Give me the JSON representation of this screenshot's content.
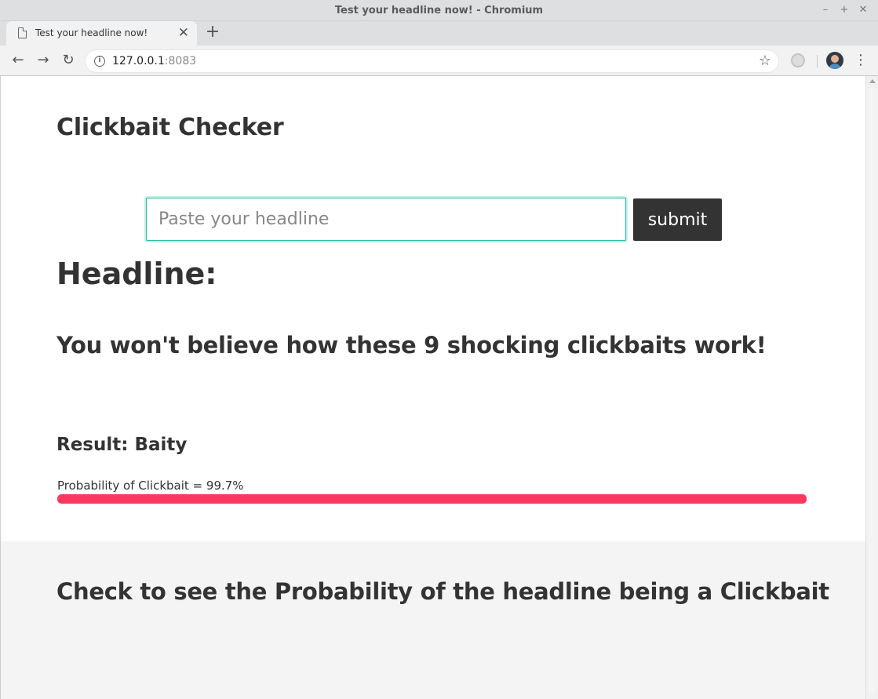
{
  "window": {
    "title": "Test your headline now! - Chromium"
  },
  "tab": {
    "label": "Test your headline now!"
  },
  "omnibox": {
    "host": "127.0.0.1",
    "port": ":8083"
  },
  "page": {
    "title": "Clickbait Checker",
    "input_placeholder": "Paste your headline",
    "input_value": "",
    "submit_label": "submit",
    "headline_label": "Headline:",
    "headline_text": "You won't believe how these 9 shocking clickbaits work!",
    "result_label": "Result: Baity",
    "probability_label": "Probability of Clickbait = 99.7%",
    "probability_value": 99.7,
    "progress_color": "#ff3860",
    "footer_text": "Check to see the Probability of the headline being a Clickbait"
  },
  "icons": {
    "back": "back-arrow-icon",
    "forward": "forward-arrow-icon",
    "reload": "reload-icon",
    "info": "info-icon",
    "bookmark": "star-icon",
    "menu": "kebab-menu-icon"
  }
}
